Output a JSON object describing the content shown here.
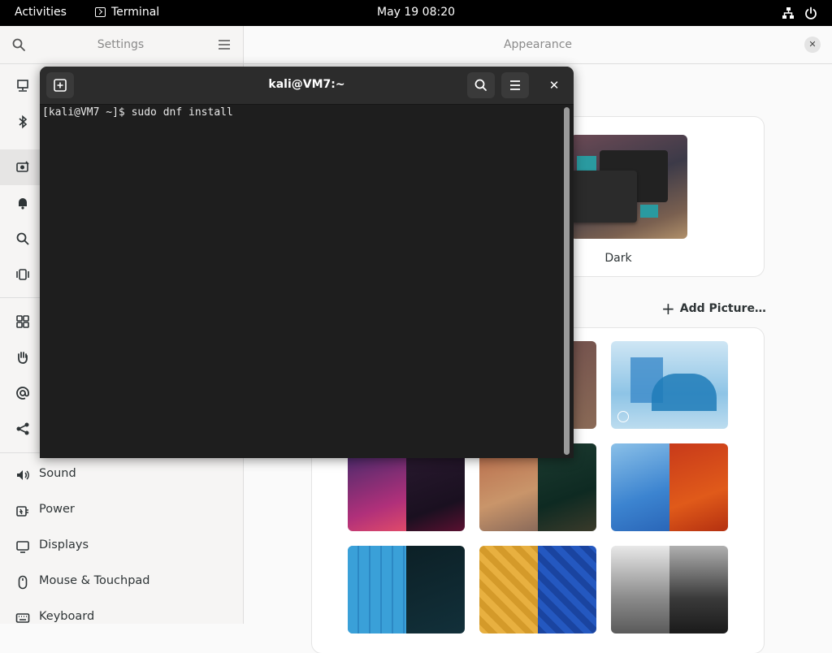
{
  "topbar": {
    "activities": "Activities",
    "app_name": "Terminal",
    "clock": "May 19  08:20",
    "icons": [
      "network-icon",
      "power-icon"
    ]
  },
  "settings": {
    "title": "Settings",
    "items": [
      {
        "icon": "network-icon",
        "label": ""
      },
      {
        "icon": "bluetooth-icon",
        "label": ""
      },
      {
        "icon": "appearance-icon",
        "label": ""
      },
      {
        "icon": "notifications-icon",
        "label": ""
      },
      {
        "icon": "search-icon",
        "label": ""
      },
      {
        "icon": "multitasking-icon",
        "label": ""
      },
      {
        "icon": "applications-icon",
        "label": ""
      },
      {
        "icon": "privacy-icon",
        "label": ""
      },
      {
        "icon": "online-accounts-icon",
        "label": ""
      },
      {
        "icon": "sharing-icon",
        "label": ""
      },
      {
        "icon": "sound-icon",
        "label": "Sound"
      },
      {
        "icon": "power-icon",
        "label": "Power"
      },
      {
        "icon": "displays-icon",
        "label": "Displays"
      },
      {
        "icon": "mouse-icon",
        "label": "Mouse & Touchpad"
      },
      {
        "icon": "keyboard-icon",
        "label": "Keyboard"
      }
    ]
  },
  "appearance": {
    "title": "Appearance",
    "style_dark_label": "Dark",
    "add_picture": "Add Picture…"
  },
  "terminal": {
    "title": "kali@VM7:~",
    "prompt": "[kali@VM7 ~]$ sudo dnf install"
  }
}
